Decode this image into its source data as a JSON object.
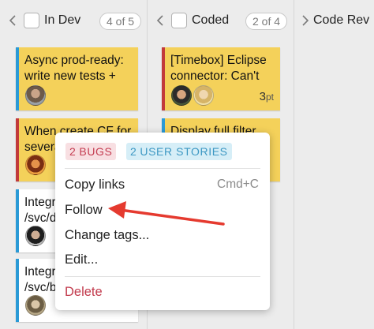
{
  "columns": [
    {
      "title": "In Dev",
      "count": "4 of 5"
    },
    {
      "title": "Coded",
      "count": "2 of 4"
    },
    {
      "title": "Code Rev"
    }
  ],
  "cards": {
    "c1": {
      "text": "Async prod-ready: write new tests +"
    },
    "c2": {
      "text": "When create CF for severa"
    },
    "c3": {
      "text": "Integr /svc/d"
    },
    "c4": {
      "text": "Integr /svc/b"
    },
    "d1": {
      "text": "[Timebox] Eclipse connector: Can't",
      "points": "3",
      "points_unit": "pt"
    },
    "d2": {
      "text": "Display full filter"
    }
  },
  "context_menu": {
    "badges": [
      {
        "count": "2",
        "label": "BUGS"
      },
      {
        "count": "2",
        "label": "USER STORIES"
      }
    ],
    "items": [
      {
        "label": "Copy links",
        "shortcut": "Cmd+C"
      },
      {
        "label": "Follow"
      },
      {
        "label": "Change tags..."
      },
      {
        "label": "Edit..."
      },
      {
        "label": "Delete"
      }
    ]
  },
  "colors": {
    "card_yellow": "#f4d15a",
    "stripe_blue": "#2a9ad6",
    "stripe_red": "#c23a3a",
    "annotation_arrow": "#e53a2f"
  }
}
